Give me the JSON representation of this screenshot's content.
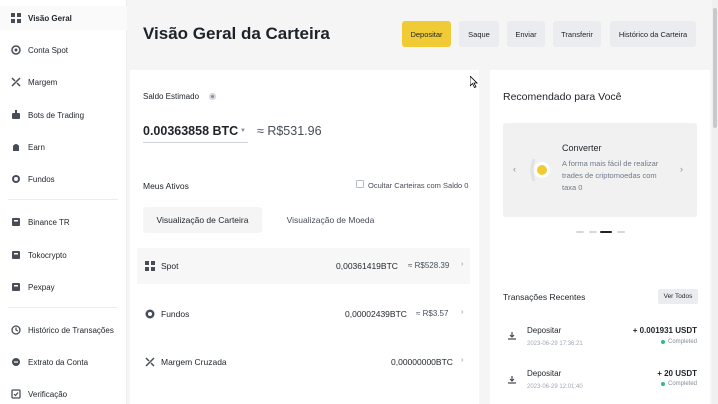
{
  "sidebar": {
    "items": [
      {
        "label": "Visão Geral",
        "icon": "grid-icon",
        "active": true
      },
      {
        "label": "Conta Spot",
        "icon": "spot-icon"
      },
      {
        "label": "Margem",
        "icon": "margin-icon"
      },
      {
        "label": "Bots de Trading",
        "icon": "bot-icon"
      },
      {
        "label": "Earn",
        "icon": "earn-icon"
      },
      {
        "label": "Fundos",
        "icon": "funds-icon"
      },
      {
        "label": "Binance TR",
        "icon": "binance-tr-icon"
      },
      {
        "label": "Tokocrypto",
        "icon": "tokocrypto-icon"
      },
      {
        "label": "Pexpay",
        "icon": "pexpay-icon"
      },
      {
        "label": "Histórico de Transações",
        "icon": "history-icon"
      },
      {
        "label": "Extrato da Conta",
        "icon": "statement-icon"
      },
      {
        "label": "Verificação",
        "icon": "verification-icon"
      }
    ]
  },
  "header": {
    "title": "Visão Geral da Carteira",
    "buttons": {
      "deposit": "Depositar",
      "withdraw": "Saque",
      "send": "Enviar",
      "transfer": "Transferir",
      "history": "Histórico da Carteira"
    }
  },
  "balance": {
    "label": "Saldo Estimado",
    "btc": "0.00363858 BTC",
    "brl": "≈ R$531.96"
  },
  "assets": {
    "title": "Meus Ativos",
    "hide_label": "Ocultar Carteiras com Saldo 0",
    "tabs": [
      "Visualização de Carteira",
      "Visualização de Moeda"
    ],
    "rows": [
      {
        "name": "Spot",
        "btc": "0,00361419BTC",
        "brl": "≈ R$528.39"
      },
      {
        "name": "Fundos",
        "btc": "0,00002439BTC",
        "brl": "≈ R$3.57"
      },
      {
        "name": "Margem Cruzada",
        "btc": "0,00000000BTC",
        "brl": ""
      }
    ]
  },
  "recommended": {
    "title": "Recomendado para Você",
    "promo_title": "Converter",
    "promo_text": "A forma mais fácil de realizar trades de criptomoedas com taxa 0",
    "prev_arrow": "‹",
    "next_arrow": "›"
  },
  "transactions": {
    "title": "Transações Recentes",
    "view_all": "Ver Todos",
    "items": [
      {
        "name": "Depositar",
        "date": "2023-06-29 17:36:21",
        "amount": "+ 0.001931 USDT",
        "status": "Completed"
      },
      {
        "name": "Depositar",
        "date": "2023-06-29 12:01:40",
        "amount": "+ 20 USDT",
        "status": "Completed"
      }
    ]
  },
  "colors": {
    "accent": "#f0cb36",
    "success": "#2ebd85",
    "text": "#1e2329"
  }
}
